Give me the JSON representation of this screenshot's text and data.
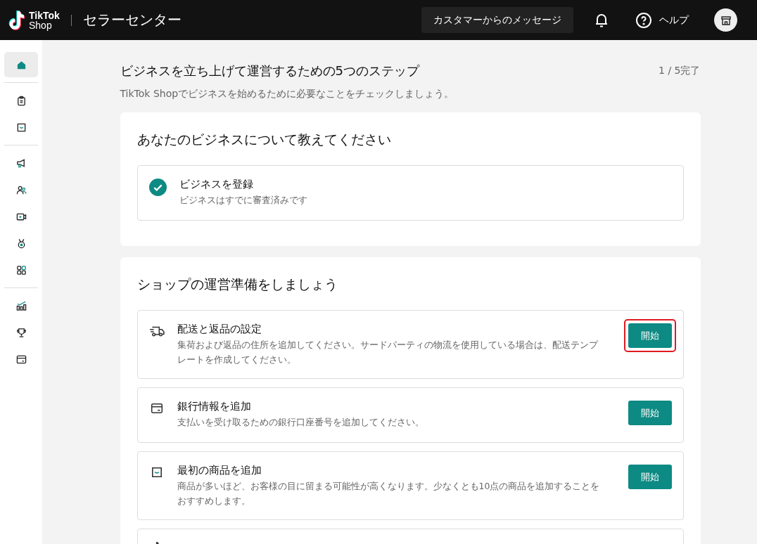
{
  "header": {
    "logo_line1": "TikTok",
    "logo_line2": "Shop",
    "title": "セラーセンター",
    "messages_button": "カスタマーからのメッセージ",
    "help": "ヘルプ"
  },
  "sidebar": {
    "groups": [
      [
        {
          "kind": "home",
          "selected": true
        }
      ],
      [
        {
          "kind": "clipboard",
          "selected": false
        },
        {
          "kind": "bag",
          "selected": false
        }
      ],
      [
        {
          "kind": "megaphone",
          "selected": false
        },
        {
          "kind": "people",
          "selected": false
        },
        {
          "kind": "video",
          "selected": false
        },
        {
          "kind": "medal",
          "selected": false
        },
        {
          "kind": "grid",
          "selected": false
        }
      ],
      [
        {
          "kind": "chart",
          "selected": false
        },
        {
          "kind": "trophy",
          "selected": false
        },
        {
          "kind": "card",
          "selected": false
        }
      ]
    ]
  },
  "page": {
    "title": "ビジネスを立ち上げて運営するための5つのステップ",
    "progress": "1 / 5完了",
    "subtitle": "TikTok Shopでビジネスを始めるために必要なことをチェックしましょう。"
  },
  "sections": [
    {
      "title": "あなたのビジネスについて教えてください",
      "steps": [
        {
          "completed": true,
          "title": "ビジネスを登録",
          "description": "ビジネスはすでに審査済みです"
        }
      ]
    },
    {
      "title": "ショップの運営準備をしましょう",
      "steps": [
        {
          "kind": "truck",
          "completed": false,
          "title": "配送と返品の設定",
          "description": "集荷および返品の住所を追加してください。サードパーティの物流を使用している場合は、配送テンプレートを作成してください。",
          "button": "開始",
          "highlighted": true
        },
        {
          "kind": "card",
          "completed": false,
          "title": "銀行情報を追加",
          "description": "支払いを受け取るための銀行口座番号を追加してください。",
          "button": "開始",
          "highlighted": false
        },
        {
          "kind": "bag",
          "completed": false,
          "title": "最初の商品を追加",
          "description": "商品が多いほど、お客様の目に留まる可能性が高くなります。少なくとも10点の商品を追加することをおすすめします。",
          "button": "開始",
          "highlighted": false
        },
        {
          "kind": "tiktok"
        }
      ]
    }
  ]
}
